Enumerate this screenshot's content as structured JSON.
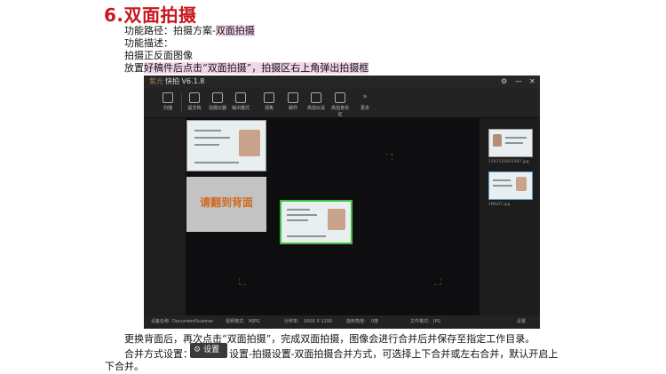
{
  "doc": {
    "title": "6.双面拍摄",
    "path_prefix": "功能路径：拍摄方案-",
    "path_hl": "双面拍摄",
    "desc_label": "功能描述：",
    "desc_text": "拍摄正反面图像",
    "step1_prefix": "放置",
    "step1_hl1": "好稿件后点击“双面拍摄”，拍摄区右上角弹出",
    "step1_hl2": "拍摄框",
    "step2": "更换背面后，再次点击“双面拍摄”，完成双面拍摄，图像会进行合并后并保存至指定工作目录。",
    "merge_label": "合并方式设置：",
    "merge_text_a": "设置-拍摄设置-双面拍摄合并方式，可选择上下合并或左右合并，默认开启上",
    "merge_text_b": "下合并。",
    "settings_button": "设置"
  },
  "app": {
    "brand": "紫光",
    "version": "快拍 V6.1.8",
    "toolbar": [
      "扫描",
      "提交档",
      "拍摄仪器",
      "输出模式",
      "调焦",
      "邮件",
      "高拍仪设",
      "高拍身份证",
      "更多"
    ],
    "flip_prompt": "请翻到背面",
    "thumbs": [
      "1597125655597.jpg",
      "1MG07.jpg"
    ],
    "status": {
      "device_label": "设备名称:",
      "device": "DocumentScanner",
      "format_label": "视频格式:",
      "format": "MJPG",
      "res_label": "分辨率:",
      "res": "1600 X 1200",
      "rot_label": "旋转角度:",
      "rot": "0度",
      "filetype_label": "文件格式:",
      "filetype": "JPG",
      "settings": "设置"
    },
    "window_controls": [
      "⚙",
      "—",
      "✕"
    ]
  },
  "colors": {
    "title_red": "#c8161d",
    "highlight": "#f2d6ea",
    "card_border": "#3fbf3f",
    "prompt_orange": "#d2691e"
  }
}
